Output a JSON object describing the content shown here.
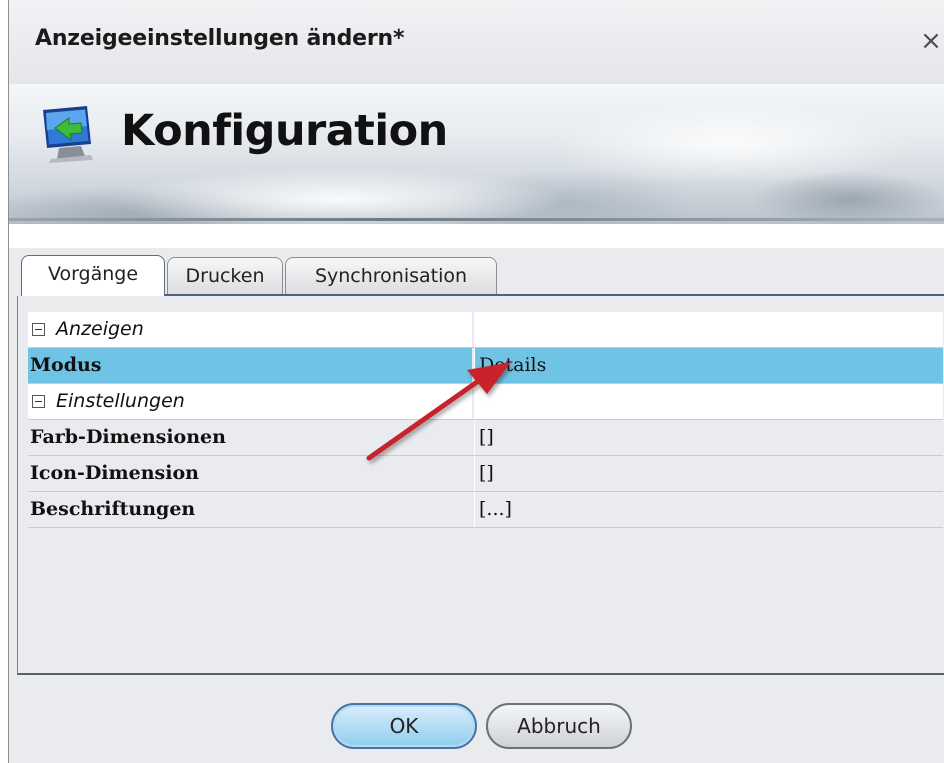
{
  "window": {
    "title": "Anzeigeeinstellungen ändern*",
    "close_glyph": "×"
  },
  "banner": {
    "title": "Konfiguration",
    "icon": "monitor-back-arrow-icon"
  },
  "tabs": [
    {
      "label": "Vorgänge",
      "active": true
    },
    {
      "label": "Drucken",
      "active": false
    },
    {
      "label": "Synchronisation",
      "active": false
    }
  ],
  "grid": {
    "categories": {
      "anzeigen": "Anzeigen",
      "einstellungen": "Einstellungen"
    },
    "properties": {
      "modus": {
        "name": "Modus",
        "value": "Details",
        "selected": true
      },
      "farb": {
        "name": "Farb-Dimensionen",
        "value": "[]"
      },
      "icon": {
        "name": "Icon-Dimension",
        "value": "[]"
      },
      "beschriftungen": {
        "name": "Beschriftungen",
        "value": "[...]"
      }
    }
  },
  "buttons": {
    "ok": "OK",
    "cancel": "Abbruch"
  },
  "colors": {
    "selected_row": "#6fc4e6",
    "annotation_arrow": "#c8202a",
    "ok_button": "#8fcdee"
  }
}
